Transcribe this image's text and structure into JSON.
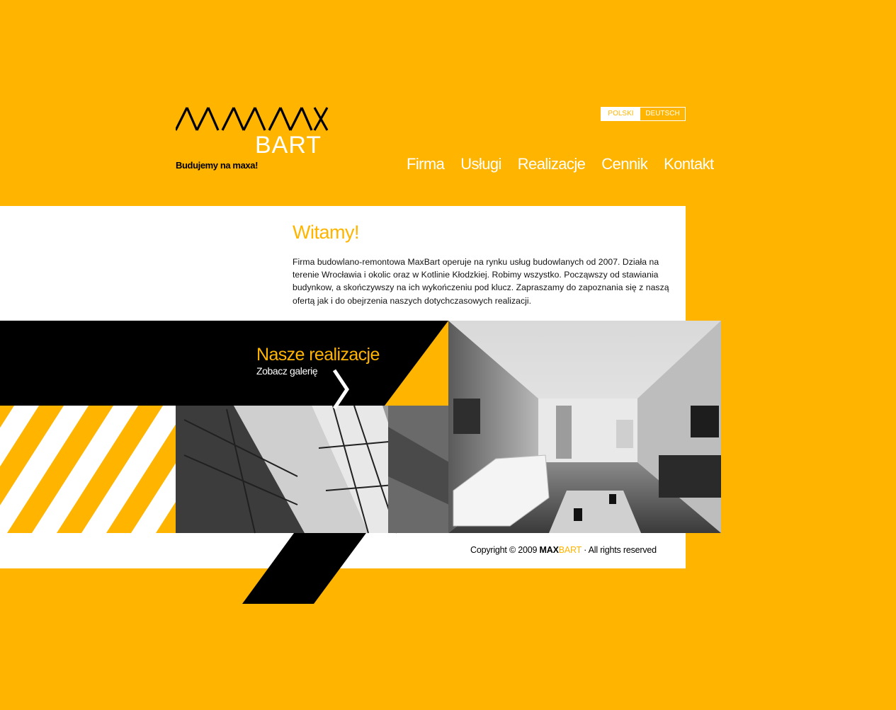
{
  "brand": {
    "logo_top": "MAX",
    "logo_bottom": "BART",
    "tagline": "Budujemy na maxa!"
  },
  "lang": {
    "polish": "POLSKI",
    "german": "DEUTSCH",
    "active": "POLSKI"
  },
  "nav": [
    {
      "label": "Firma"
    },
    {
      "label": "Usługi"
    },
    {
      "label": "Realizacje"
    },
    {
      "label": "Cennik"
    },
    {
      "label": "Kontakt"
    }
  ],
  "welcome": {
    "title": "Witamy!",
    "text": "Firma budowlano-remontowa MaxBart operuje na rynku usług budowlanych od 2007. Działa na terenie Wrocławia i okolic oraz w Kotlinie Kłodzkiej. Robimy wszystko. Począwszy od stawiania budynkow, a skończywszy na ich wykończeniu pod klucz. Zapraszamy do zapoznania się z naszą ofertą jak i do obejrzenia naszych dotychczasowych realizacji."
  },
  "gallery": {
    "title": "Nasze realizacje",
    "subtitle": "Zobacz galerię"
  },
  "footer": {
    "prefix": "Copyright © 2009",
    "brand_max": "MAX",
    "brand_bart": "BART",
    "suffix": "· All rights reserved"
  },
  "colors": {
    "accent": "#FFB400",
    "dark": "#000000",
    "light": "#FFFFFF"
  }
}
